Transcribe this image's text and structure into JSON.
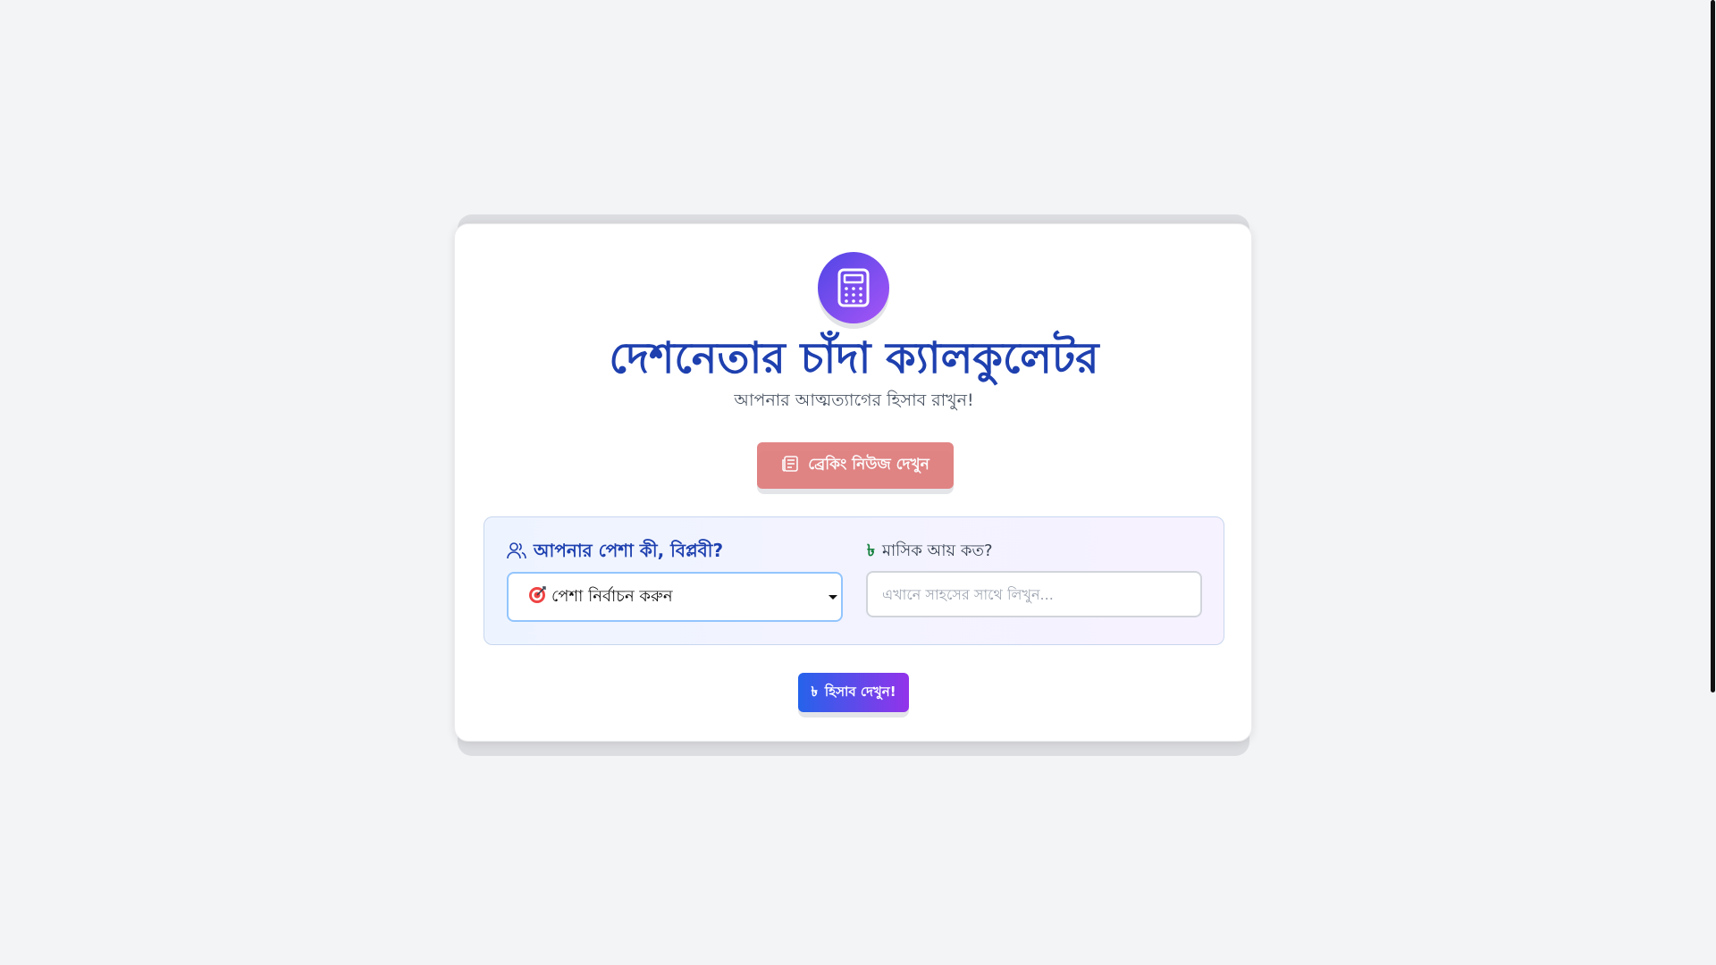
{
  "header": {
    "title": "দেশনেতার চাঁদা ক্যালকুলেটর",
    "subtitle": "আপনার আত্মত্যাগের হিসাব রাখুন!"
  },
  "news_button": {
    "label": "ব্রেকিং নিউজ দেখুন",
    "icon": "newspaper-icon"
  },
  "form": {
    "profession_label": "আপনার পেশা কী, বিপ্লবী?",
    "profession_icon": "users-icon",
    "profession_select": {
      "selected": "পেশা নির্বাচন করুন",
      "icon": "target-icon"
    },
    "income_label": "মাসিক আয় কত?",
    "income_icon_glyph": "৳",
    "income_input": {
      "value": "",
      "placeholder": "এখানে সাহসের সাথে লিখুন..."
    }
  },
  "calculate_button": {
    "label": "হিসাব দেখুন!",
    "icon_glyph": "৳"
  },
  "colors": {
    "title": "#1e40af",
    "accent_gradient_start": "#2563eb",
    "accent_gradient_end": "#9333ea",
    "news_button": "#e07b7b",
    "taka_green": "#15803d"
  }
}
